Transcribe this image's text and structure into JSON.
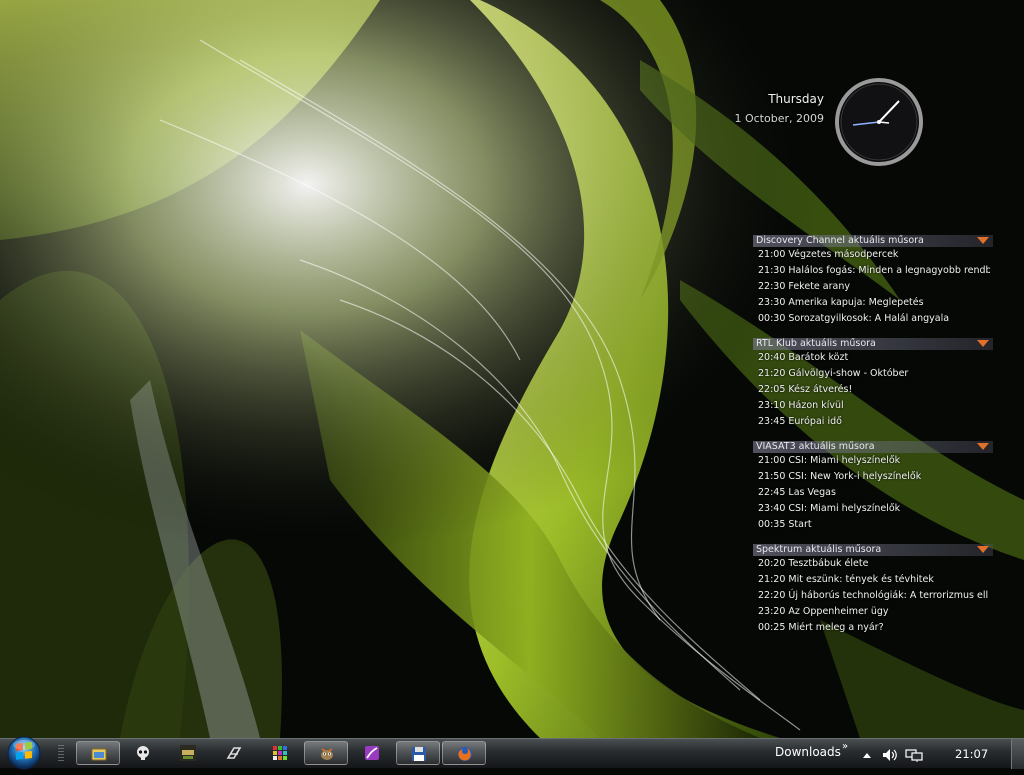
{
  "clock": {
    "day": "Thursday",
    "date": "1 October, 2009"
  },
  "tv_gadget": {
    "channels": [
      {
        "title": "Discovery Channel aktuális műsora",
        "programs": [
          "21:00 Végzetes másodpercek",
          "21:30 Halálos fogás: Minden a legnagyobb rendb",
          "22:30 Fekete arany",
          "23:30 Amerika kapuja: Meglepetés",
          "00:30 Sorozatgyilkosok: A Halál angyala"
        ]
      },
      {
        "title": "RTL Klub aktuális műsora",
        "programs": [
          "20:40 Barátok közt",
          "21:20 Gálvölgyi-show - Október",
          "22:05 Kész átverés!",
          "23:10 Házon kívül",
          "23:45 Európai idő"
        ]
      },
      {
        "title": "VIASAT3 aktuális műsora",
        "programs": [
          "21:00 CSI: Miami helyszínelők",
          "21:50 CSI: New York-i helyszínelők",
          "22:45 Las Vegas",
          "23:40 CSI: Miami helyszínelők",
          "00:35 Start"
        ]
      },
      {
        "title": "Spektrum aktuális műsora",
        "programs": [
          "20:20 Tesztbábuk élete",
          "21:20 Mit eszünk: tények és tévhitek",
          "22:20 Új háborús technológiák: A terrorizmus ell",
          "23:20 Az Oppenheimer ügy",
          "00:25 Miért meleg a nyár?"
        ]
      }
    ]
  },
  "taskbar": {
    "start_icon": "windows-orb-icon",
    "items": [
      {
        "icon": "explorer-icon",
        "active": true
      },
      {
        "icon": "skull-icon",
        "active": false
      },
      {
        "icon": "mfw-game-icon",
        "active": false
      },
      {
        "icon": "nfs-icon",
        "active": false
      },
      {
        "icon": "colorful-grid-icon",
        "active": false
      },
      {
        "icon": "gimp-icon",
        "active": true
      },
      {
        "icon": "purple-app-icon",
        "active": false
      },
      {
        "icon": "floppy-save-icon",
        "active": true
      },
      {
        "icon": "firefox-icon",
        "active": true
      }
    ],
    "toolbar_label": "Downloads",
    "toolbar_chevron": "»",
    "time": "21:07"
  },
  "colors": {
    "accent_green": "#b8d43a",
    "taskbar_dark": "#1c1f22",
    "arrow_orange": "#e0702a"
  }
}
